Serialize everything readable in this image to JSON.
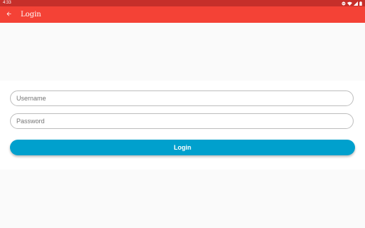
{
  "status_bar": {
    "time": "4:33",
    "icons": [
      "do-not-disturb-icon",
      "wifi-icon",
      "cell-signal-icon",
      "battery-icon"
    ]
  },
  "app_bar": {
    "title": "Login",
    "back_icon": "arrow-back-icon"
  },
  "form": {
    "username_placeholder": "Username",
    "username_value": "",
    "password_placeholder": "Password",
    "password_value": "",
    "login_label": "Login"
  },
  "colors": {
    "status_bar": "#c62f2a",
    "app_bar": "#f44236",
    "button": "#00a0cd",
    "background": "#fafafa",
    "card": "#ffffff"
  }
}
